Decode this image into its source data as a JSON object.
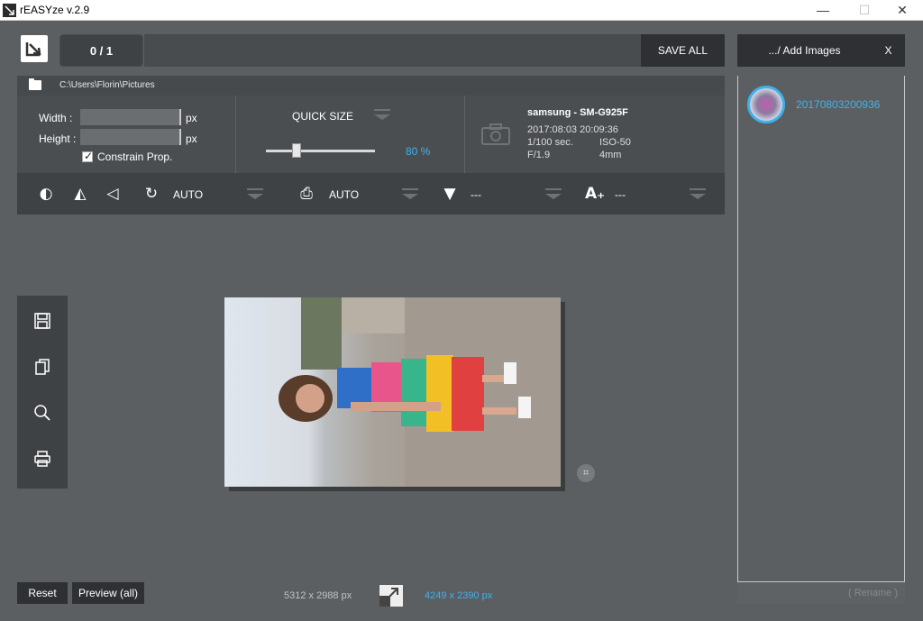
{
  "window": {
    "title": "rEASYze v.2.9",
    "minimize_label": "—",
    "maximize_label": "☐",
    "close_label": "✕"
  },
  "toolbar": {
    "counter": "0 / 1",
    "save_all": "SAVE ALL",
    "add_images": ".../ Add Images",
    "clear_images": "X"
  },
  "path": {
    "folder_icon": "folder-icon",
    "text": "C:\\Users\\Florin\\Pictures"
  },
  "size": {
    "width_label": "Width :",
    "height_label": "Height :",
    "width_value": "",
    "height_value": "",
    "unit": "px",
    "constrain_label": "Constrain Prop.",
    "constrain_checked": true
  },
  "quick_size": {
    "label": "QUICK SIZE",
    "value": "80 %",
    "percent": 80
  },
  "exif": {
    "camera": "samsung - SM-G925F",
    "datetime": "2017:08:03 20:09:36",
    "shutter": "1/100 sec.",
    "iso": "ISO-50",
    "aperture": "F/1.9",
    "focal": "4mm"
  },
  "tools": {
    "rotate_value": "AUTO",
    "print_value": "AUTO",
    "filter_value": "---",
    "text_value": "---"
  },
  "files": [
    {
      "name": "20170803200936"
    }
  ],
  "rename_label": "( Rename )",
  "bottom": {
    "reset": "Reset",
    "preview_all": "Preview (all)",
    "original_size": "5312 x 2988 px",
    "new_size": "4249 x 2390 px"
  },
  "colors": {
    "accent": "#3fb2ee",
    "background": "#5b5f62",
    "dark": "#2e3033"
  }
}
